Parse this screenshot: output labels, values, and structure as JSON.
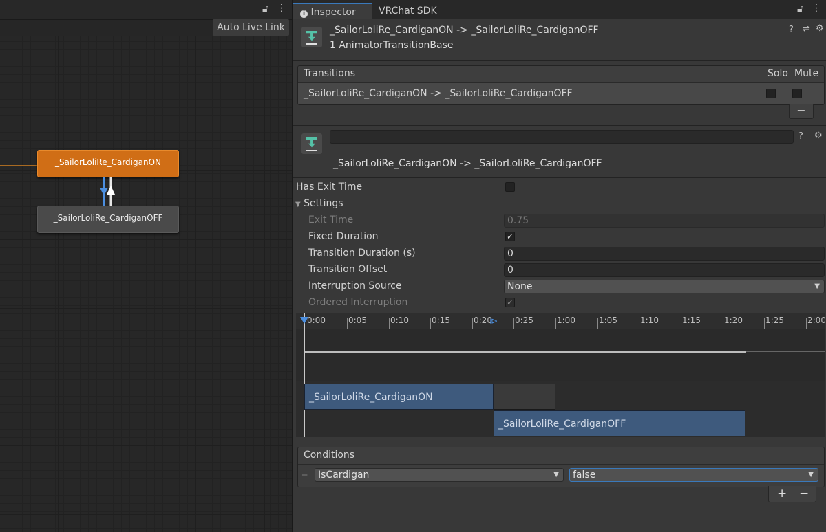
{
  "animator": {
    "auto_live_link": "Auto Live Link",
    "lock_icon": "lock-icon",
    "menu_icon": "kebab-menu-icon",
    "states": {
      "on": "_SailorLoliRe_CardiganON",
      "off": "_SailorLoliRe_CardiganOFF"
    }
  },
  "inspector": {
    "tabs": [
      "Inspector",
      "VRChat SDK"
    ],
    "header": {
      "title": "_SailorLoliRe_CardiganON -> _SailorLoliRe_CardiganOFF",
      "subtitle": "1 AnimatorTransitionBase"
    },
    "transitions": {
      "header": "Transitions",
      "solo": "Solo",
      "mute": "Mute",
      "rows": [
        "_SailorLoliRe_CardiganON -> _SailorLoliRe_CardiganOFF"
      ],
      "remove_label": "−"
    },
    "transition": {
      "name_value": "",
      "title": "_SailorLoliRe_CardiganON -> _SailorLoliRe_CardiganOFF"
    },
    "fields": {
      "has_exit_time": "Has Exit Time",
      "settings": "Settings",
      "exit_time": "Exit Time",
      "exit_time_value": "0.75",
      "fixed_duration": "Fixed Duration",
      "transition_duration": "Transition Duration (s)",
      "transition_duration_value": "0",
      "transition_offset": "Transition Offset",
      "transition_offset_value": "0",
      "interruption_source": "Interruption Source",
      "interruption_source_value": "None",
      "ordered_interruption": "Ordered Interruption"
    },
    "timeline": {
      "ticks": [
        "0:00",
        "0:05",
        "0:10",
        "0:15",
        "0:20",
        "0:25",
        "1:00",
        "1:05",
        "1:10",
        "1:15",
        "1:20",
        "1:25",
        "2:00"
      ],
      "clip_on": "_SailorLoliRe_CardiganON",
      "clip_off": "_SailorLoliRe_CardiganOFF"
    },
    "conditions": {
      "header": "Conditions",
      "parameter": "IsCardigan",
      "value": "false",
      "add_label": "+",
      "remove_label": "−"
    }
  },
  "colors": {
    "state_on": "#d06e16",
    "state_off": "#4a4a4a",
    "clip": "#3e5a7d",
    "accent": "#3a79bb"
  }
}
